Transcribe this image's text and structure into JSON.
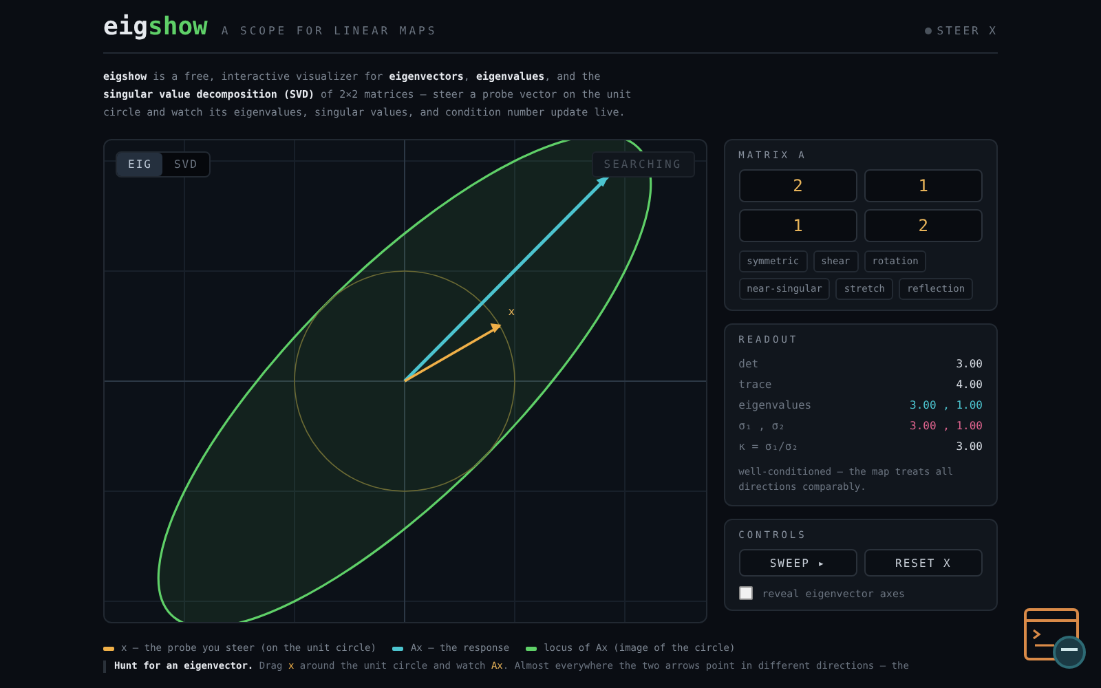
{
  "header": {
    "logo_prefix": "eig",
    "logo_suffix": "show",
    "tagline": "A SCOPE FOR LINEAR MAPS",
    "status": "STEER X"
  },
  "intro": "**eigshow** is a free, interactive visualizer for **eigenvectors**, **eigenvalues**, and the **singular value decomposition (SVD)** of 2×2 matrices — steer a probe vector on the unit circle and watch its eigenvalues, singular values, and condition number update live.",
  "plot": {
    "modes": [
      {
        "label": "EIG",
        "selected": true
      },
      {
        "label": "SVD",
        "selected": false
      }
    ],
    "badge": "SEARCHING",
    "probe_label": "x"
  },
  "matrix": {
    "title": "MATRIX A",
    "entries": [
      "2",
      "1",
      "1",
      "2"
    ],
    "presets": [
      "symmetric",
      "shear",
      "rotation",
      "near-singular",
      "stretch",
      "reflection"
    ]
  },
  "readout": {
    "title": "READOUT",
    "rows": [
      {
        "label": "det",
        "kind": "single",
        "value": "3.00"
      },
      {
        "label": "trace",
        "kind": "single",
        "value": "4.00"
      },
      {
        "label": "eigenvalues",
        "kind": "pair",
        "values": [
          "3.00",
          ",",
          "1.00"
        ],
        "color": "#4cc4cf"
      },
      {
        "label": "σ₁ , σ₂",
        "kind": "pair",
        "values": [
          "3.00",
          ",",
          "1.00"
        ],
        "color": "#e0648f"
      },
      {
        "label": "κ = σ₁/σ₂",
        "kind": "single",
        "value": "3.00"
      }
    ],
    "note": "well-conditioned — the map treats all directions comparably."
  },
  "controls": {
    "title": "CONTROLS",
    "buttons": [
      "SWEEP ▸",
      "RESET X"
    ],
    "checkbox": {
      "label": "reveal eigenvector axes",
      "checked": false
    }
  },
  "legend": [
    {
      "label": "x — the probe you steer (on the unit circle)",
      "color": "#f0b048"
    },
    {
      "label": "Ax — the response",
      "color": "#4cc4cf"
    },
    {
      "label": "locus of Ax (image of the circle)",
      "color": "#5fd068"
    }
  ],
  "hint": [
    {
      "text": "Hunt for an eigenvector.",
      "kind": "bold"
    },
    {
      "text": " Drag ",
      "kind": "plain"
    },
    {
      "text": "x",
      "kind": "probe"
    },
    {
      "text": " around the unit circle and watch ",
      "kind": "plain"
    },
    {
      "text": "Ax",
      "kind": "response"
    },
    {
      "text": ". Almost everywhere the two arrows point in different directions — the",
      "kind": "plain"
    }
  ]
}
